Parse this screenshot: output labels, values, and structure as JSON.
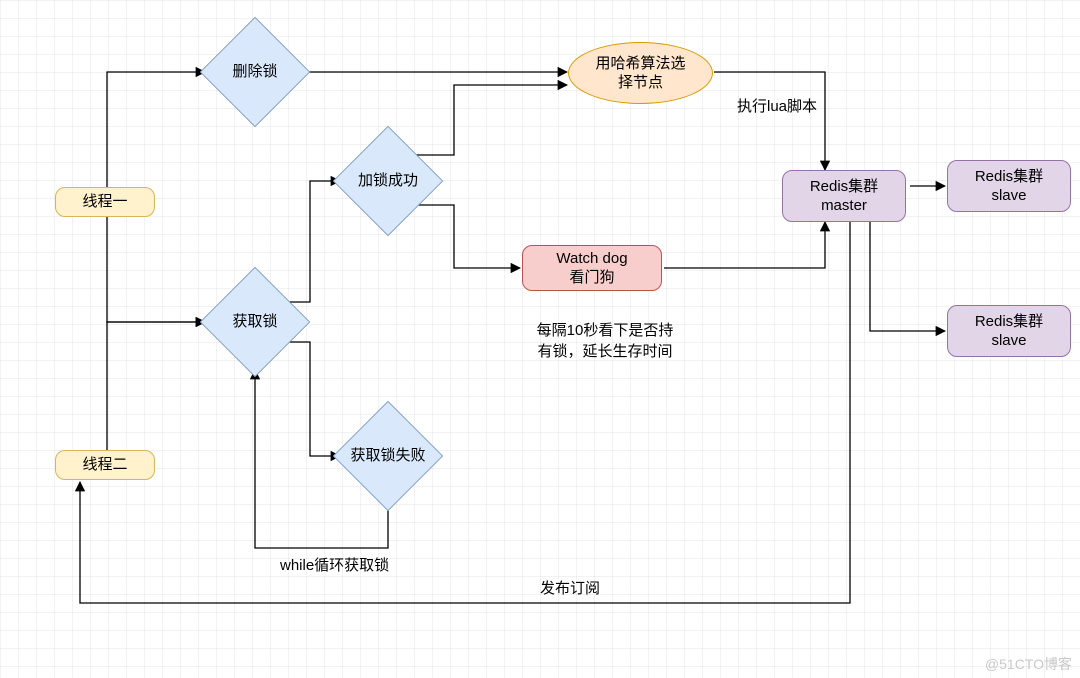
{
  "nodes": {
    "thread1": "线程一",
    "thread2": "线程二",
    "deleteLock": "删除锁",
    "acquireLock": "获取锁",
    "lockSuccess": "加锁成功",
    "lockFail": "获取锁失败",
    "hashSelect": "用哈希算法选\n择节点",
    "watchdog": "Watch dog\n看门狗",
    "redisMaster": "Redis集群\nmaster",
    "redisSlave1": "Redis集群\nslave",
    "redisSlave2": "Redis集群\nslave"
  },
  "labels": {
    "executeLua": "执行lua脚本",
    "watchdogDesc": "每隔10秒看下是否持\n有锁，延长生存时间",
    "whileLoop": "while循环获取锁",
    "pubsub": "发布订阅"
  },
  "watermark": "@51CTO博客",
  "colors": {
    "yellowFill": "#fff2cc",
    "yellowStroke": "#d6b656",
    "blueFill": "#dae8fc",
    "blueStroke": "#6c8ebf",
    "orangeFill": "#ffe6cc",
    "orangeStroke": "#d79b00",
    "redFill": "#f8cecc",
    "redStroke": "#b85450",
    "purpleFill": "#e1d5e7",
    "purpleStroke": "#9673a6"
  }
}
